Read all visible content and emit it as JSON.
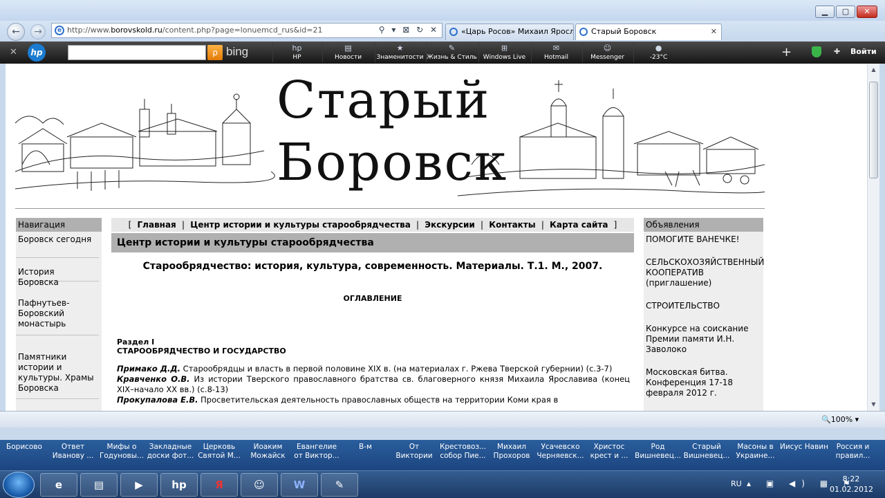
{
  "window": {
    "address_url_prefix": "http://www.",
    "address_url_domain": "borovskold.ru",
    "address_url_path": "/content.php?page=lonuemcd_rus&id=21",
    "address_tools": "⚲ ▾ ⊠ ↻ ✕",
    "tabs": [
      {
        "title": "«Царь Росов» Михаил Яросл..."
      },
      {
        "title": "Старый Боровск",
        "close": "✕"
      }
    ]
  },
  "hp_toolbar": {
    "close": "✕",
    "logo": "hp",
    "search_button": "ρ",
    "bing_label": "bing",
    "items": [
      {
        "icon": "hp",
        "label": "HP"
      },
      {
        "icon": "▤",
        "label": "Новости"
      },
      {
        "icon": "★",
        "label": "Знаменитости"
      },
      {
        "icon": "✎",
        "label": "Жизнь & Стиль"
      },
      {
        "icon": "⊞",
        "label": "Windows Live"
      },
      {
        "icon": "✉",
        "label": "Hotmail"
      },
      {
        "icon": "☺",
        "label": "Messenger"
      },
      {
        "icon": "●",
        "label": "-23°C"
      }
    ],
    "add": "+",
    "wrench": "✚",
    "login": "Войти"
  },
  "banner": {
    "title_line1": "Старый",
    "title_line2": "Боровск"
  },
  "leftnav": {
    "heading": "Навигация",
    "items": [
      "Боровск сегодня",
      "История Боровска",
      "Пафнутьев-Боровский монастырь",
      "Памятники истории и культуры. Храмы Боровска"
    ]
  },
  "topmenu": {
    "open": "[",
    "close": "]",
    "sep": "|",
    "items": [
      "Главная",
      "Центр истории и культуры старообрядчества",
      "Экскурсии",
      "Контакты",
      "Карта сайта"
    ]
  },
  "content": {
    "section_title": "Центр истории и культуры старообрядчества",
    "book_title": "Старообрядчество: история, культура, современность. Материалы. Т.1. М., 2007.",
    "toc_title": "ОГЛАВЛЕНИЕ",
    "part_label": "Раздел I",
    "part_name": "СТАРООБРЯДЧЕСТВО И ГОСУДАРСТВО",
    "entries": [
      {
        "author": "Примако Д.Д.",
        "text": "Старообрядцы и власть в первой половине XIX в. (на материалах г. Ржева Тверской губернии) (с.3-7)"
      },
      {
        "author": "Кравченко О.В.",
        "text": "Из истории Тверского православного братства св. благоверного князя Михаила Ярославива (конец XIX–начало XX вв.) (с.8-13)"
      },
      {
        "author": "Прокупалова Е.В.",
        "text": "Просветительская деятельность православных обществ на территории Коми края в"
      }
    ]
  },
  "rightcol": {
    "heading": "Объявления",
    "items": [
      "ПОМОГИТЕ ВАНЕЧКЕ!",
      "СЕЛЬСКОХОЗЯЙСТВЕННЫЙ КООПЕРАТИВ (приглашение)",
      "СТРОИТЕЛЬСТВО",
      "Конкурсе на соискание Премии памяти И.Н. Заволоко",
      "Московская битва. Конференция 17-18 февраля 2012 г."
    ]
  },
  "statusbar": {
    "zoom": "🔍100%  ▾"
  },
  "quick_links": [
    "Борисово",
    "Ответ Иванову ...",
    "Мифы о Годуновы...",
    "Закладные доски фот...",
    "Церковь Святой М...",
    "Иоаким Можайск",
    "Евангелие от Виктор...",
    "В-м",
    "От Виктории",
    "Крестовоз... собор Пие...",
    "Михаил Прохоров",
    "Усачевско Черняевск...",
    "Христос крест и ...",
    "Род Вишневец...",
    "Старый Вишневец...",
    "Масоны в Украине...",
    "Иисус Навин",
    "Россия и правил..."
  ],
  "taskbar": {
    "buttons": [
      "e",
      "▤",
      "▶",
      "hp",
      "Я",
      "☺",
      "W",
      "✎"
    ],
    "lang": "RU",
    "tray_icons": "▴ ▣ ◀) ▦ ⚑",
    "time": "8:22",
    "date": "01.02.2012"
  },
  "colors": {
    "section_gray": "#b0b0b0",
    "column_bg": "#eeeeee",
    "menu_bg": "#e6e6e6"
  }
}
